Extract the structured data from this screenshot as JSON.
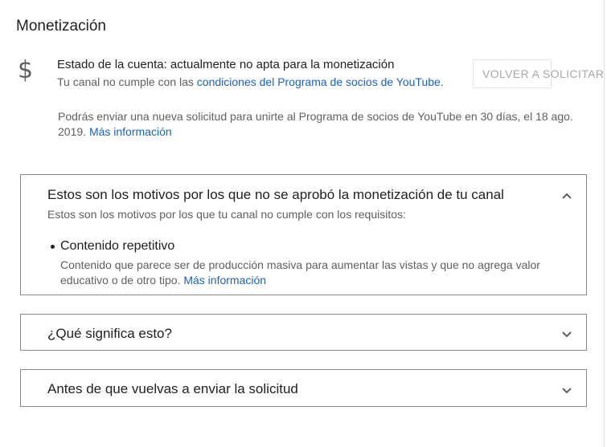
{
  "monetization": {
    "title": "Monetización",
    "icon": "dollar-icon",
    "icon_glyph": "$",
    "status_text": "Estado de la cuenta: actualmente no apta para la monetización",
    "requirement_prefix": "Tu canal no cumple con las ",
    "requirement_link": "condiciones del Programa de socios de YouTube",
    "requirement_suffix": ".",
    "reapply_button": "VOLVER A SOLICITAR",
    "info_text": "Podrás enviar una nueva solicitud para unirte al Programa de socios de YouTube en 30 días, el 18 ago. 2019.",
    "info_link": "Más información"
  },
  "panels": [
    {
      "title": "Estos son los motivos por los que no se aprobó la monetización de tu canal",
      "subtitle": "Estos son los motivos por los que tu canal no cumple con los requisitos:",
      "expanded": true,
      "chevron_icon": "chevron-up-icon",
      "reasons": [
        {
          "title": "Contenido repetitivo",
          "description": "Contenido que parece ser de producción masiva para aumentar las vistas y que no agrega valor educativo o de otro tipo.",
          "link": "Más información"
        }
      ]
    },
    {
      "title": "¿Qué significa esto?",
      "expanded": false,
      "chevron_icon": "chevron-down-icon"
    },
    {
      "title": "Antes de que vuelvas a enviar la solicitud",
      "expanded": false,
      "chevron_icon": "chevron-down-icon"
    }
  ],
  "colors": {
    "link": "#1a62c0",
    "text_primary": "#212121",
    "text_secondary": "#606060",
    "panel_border": "#8a8a8a",
    "disabled_button_text": "#a8a8a8"
  }
}
